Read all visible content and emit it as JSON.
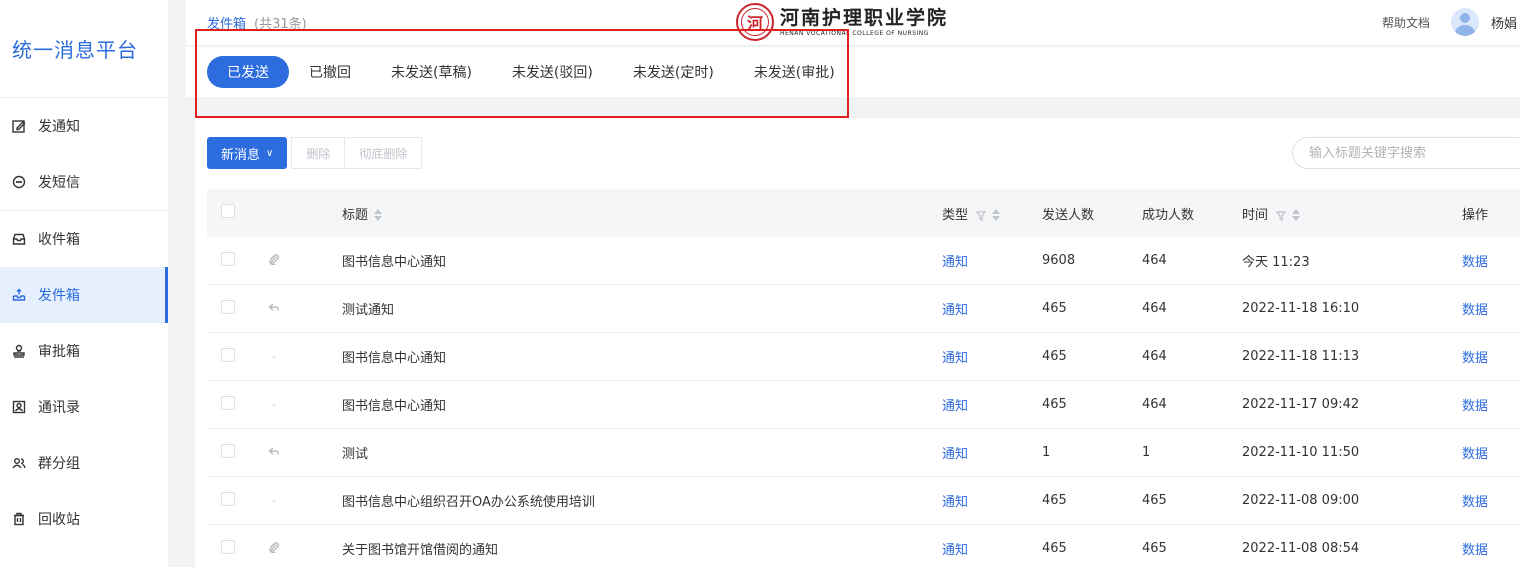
{
  "sidebar": {
    "brand": "统一消息平台",
    "items": [
      {
        "label": "发通知",
        "icon": "edit-icon"
      },
      {
        "label": "发短信",
        "icon": "chat-icon"
      },
      {
        "label": "收件箱",
        "icon": "inbox-icon"
      },
      {
        "label": "发件箱",
        "icon": "outbox-icon",
        "active": true
      },
      {
        "label": "审批箱",
        "icon": "stamp-icon"
      },
      {
        "label": "通讯录",
        "icon": "contacts-icon"
      },
      {
        "label": "群分组",
        "icon": "group-icon"
      },
      {
        "label": "回收站",
        "icon": "trash-icon"
      }
    ]
  },
  "header": {
    "breadcrumb": "发件箱",
    "count": "(共31条)",
    "logo_cn": "河南护理职业学院",
    "logo_en": "HENAN VOCATIONAL COLLEGE OF NURSING",
    "help": "帮助文档",
    "username": "杨娟"
  },
  "tabs": [
    {
      "label": "已发送",
      "active": true
    },
    {
      "label": "已撤回"
    },
    {
      "label": "未发送(草稿)"
    },
    {
      "label": "未发送(驳回)"
    },
    {
      "label": "未发送(定时)"
    },
    {
      "label": "未发送(审批)"
    }
  ],
  "toolbar": {
    "new_label": "新消息",
    "delete_label": "删除",
    "purge_label": "彻底删除",
    "search_placeholder": "输入标题关键字搜索"
  },
  "table": {
    "headers": {
      "title": "标题",
      "type": "类型",
      "sent": "发送人数",
      "success": "成功人数",
      "time": "时间",
      "op": "操作"
    },
    "rows": [
      {
        "att": "attachment-icon",
        "title": "图书信息中心通知",
        "type": "通知",
        "sent": "9608",
        "success": "464",
        "time": "今天 11:23",
        "op": "数据"
      },
      {
        "att": "reply-icon",
        "title": "测试通知",
        "type": "通知",
        "sent": "465",
        "success": "464",
        "time": "2022-11-18 16:10",
        "op": "数据"
      },
      {
        "att": "dash",
        "title": "图书信息中心通知",
        "type": "通知",
        "sent": "465",
        "success": "464",
        "time": "2022-11-18 11:13",
        "op": "数据"
      },
      {
        "att": "dash",
        "title": "图书信息中心通知",
        "type": "通知",
        "sent": "465",
        "success": "464",
        "time": "2022-11-17 09:42",
        "op": "数据"
      },
      {
        "att": "reply-icon",
        "title": "测试",
        "type": "通知",
        "sent": "1",
        "success": "1",
        "time": "2022-11-10 11:50",
        "op": "数据"
      },
      {
        "att": "dash",
        "title": "图书信息中心组织召开OA办公系统使用培训",
        "type": "通知",
        "sent": "465",
        "success": "465",
        "time": "2022-11-08 09:00",
        "op": "数据"
      },
      {
        "att": "attachment-icon",
        "title": "关于图书馆开馆借阅的通知",
        "type": "通知",
        "sent": "465",
        "success": "465",
        "time": "2022-11-08 08:54",
        "op": "数据"
      }
    ]
  }
}
